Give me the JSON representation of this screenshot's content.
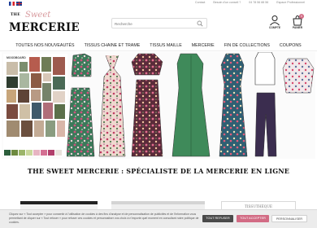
{
  "topbar": {
    "languages": [
      "FR",
      "EN"
    ],
    "links": [
      "Contact",
      "Besoin d'un conseil ?",
      "04 78 56 88 56",
      "Espace Professionnel"
    ]
  },
  "logo": {
    "the": "THE",
    "sweet": "Sweet",
    "mercerie": "MERCERIE"
  },
  "search": {
    "placeholder": "Recherche"
  },
  "header": {
    "account_label": "COMPTE",
    "cart_label": "PANIER",
    "cart_count": "0"
  },
  "nav": {
    "items": [
      "TOUTES NOS NOUVEAUTÉS",
      "TISSUS CHAINE ET TRAME",
      "TISSUS MAILLE",
      "MERCERIE",
      "FIN DE COLLECTIONS",
      "COUPONS"
    ]
  },
  "hero": {
    "board_title": "MOODBOARD"
  },
  "headline": "THE SWEET MERCERIE : SPÉCIALISTE DE LA MERCERIE EN LIGNE",
  "previews": {
    "third_label": "TISSUTHÈQUE"
  },
  "cookie": {
    "text": "Cliquez sur « Tout accepter » pour consentir à l'utilisation de cookies à des fins d'analyse et de personnalisation de publicités et de l'information vous permettant de cliquer sur « Tout refuser » pour refuser ces cookies et personnaliser vos choix à n'importe quel moment en consultant notre politique de cookies.",
    "refuse": "TOUT REFUSER",
    "accept": "TOUT ACCEPTER",
    "customize": "PERSONNALISER"
  },
  "colors": {
    "accent": "#d26b84",
    "sweet_pink": "#d7999d",
    "cookie_bg": "#ececec"
  }
}
